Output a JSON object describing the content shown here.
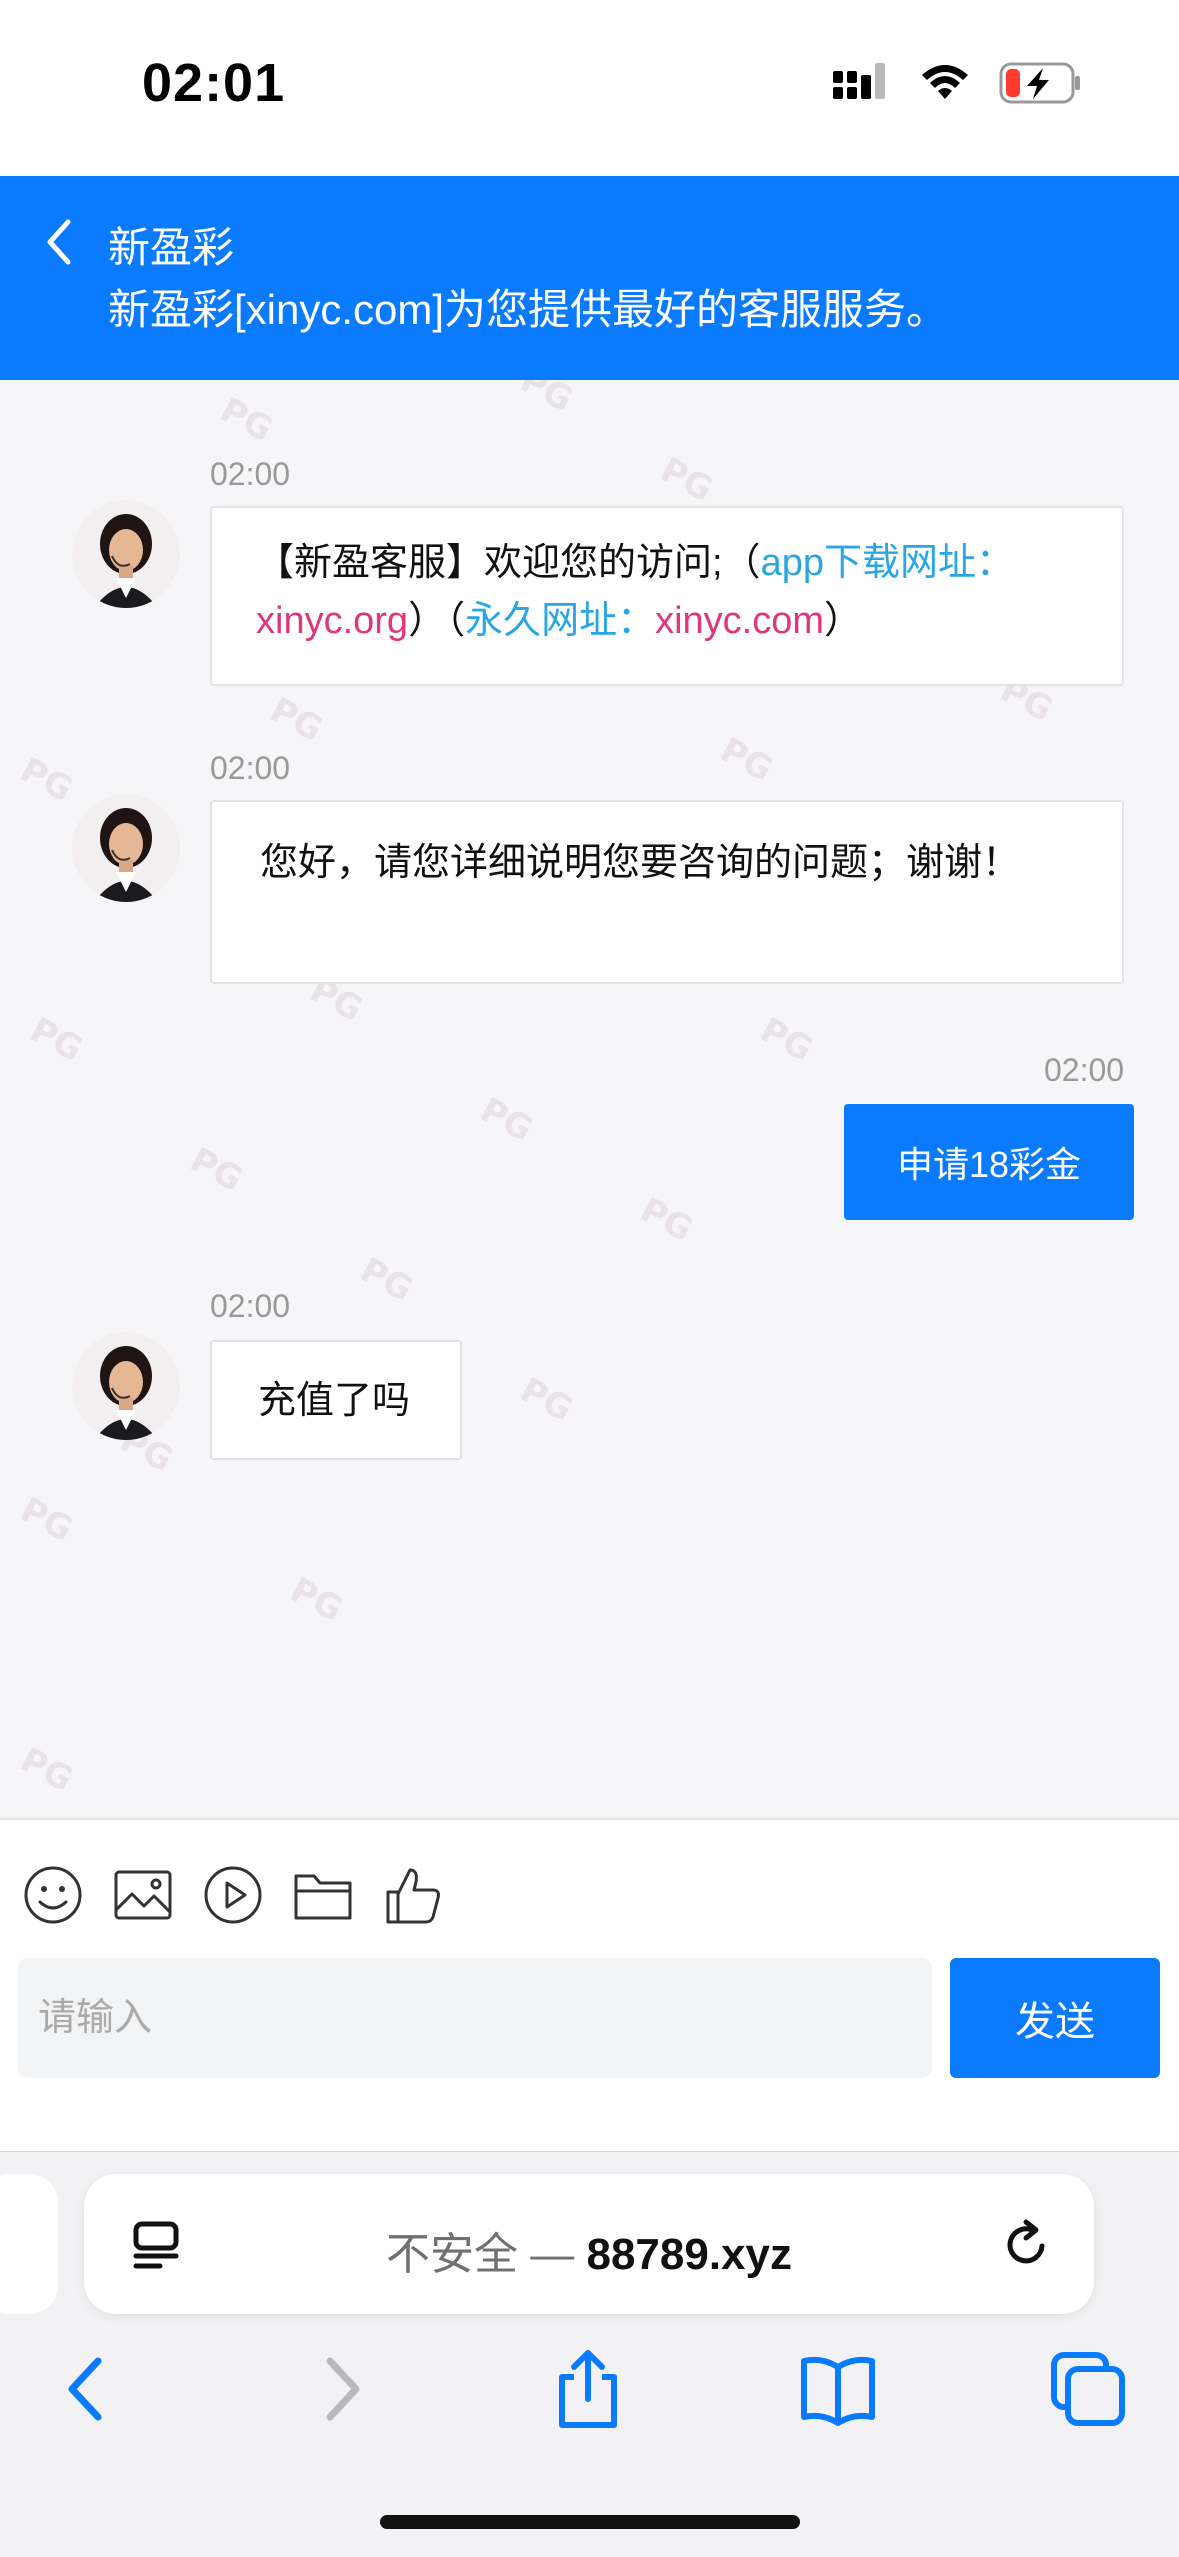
{
  "status_bar": {
    "time": "02:01"
  },
  "header": {
    "title": "新盈彩",
    "subtitle": "新盈彩[xinyc.com]为您提供最好的客服服务。"
  },
  "messages": [
    {
      "time": "02:00",
      "parts": [
        "【新盈客服】欢迎您的访问;（",
        "app下载网址：",
        "xinyc.org",
        "）（",
        "永久网址：",
        "xinyc.com",
        "）"
      ]
    },
    {
      "time": "02:00",
      "text": "您好，请您详细说明您要咨询的问题；谢谢！"
    },
    {
      "time": "02:00",
      "text": "申请18彩金"
    },
    {
      "time": "02:00",
      "text": "充值了吗"
    }
  ],
  "composer": {
    "placeholder": "请输入",
    "send_label": "发送"
  },
  "browser": {
    "insecure_label": "不安全 —",
    "domain": "88789.xyz"
  },
  "watermark_text": "PG",
  "colors": {
    "primary": "#0a7bff",
    "link_blue": "#2aa6e6",
    "link_pink": "#e0367d"
  }
}
